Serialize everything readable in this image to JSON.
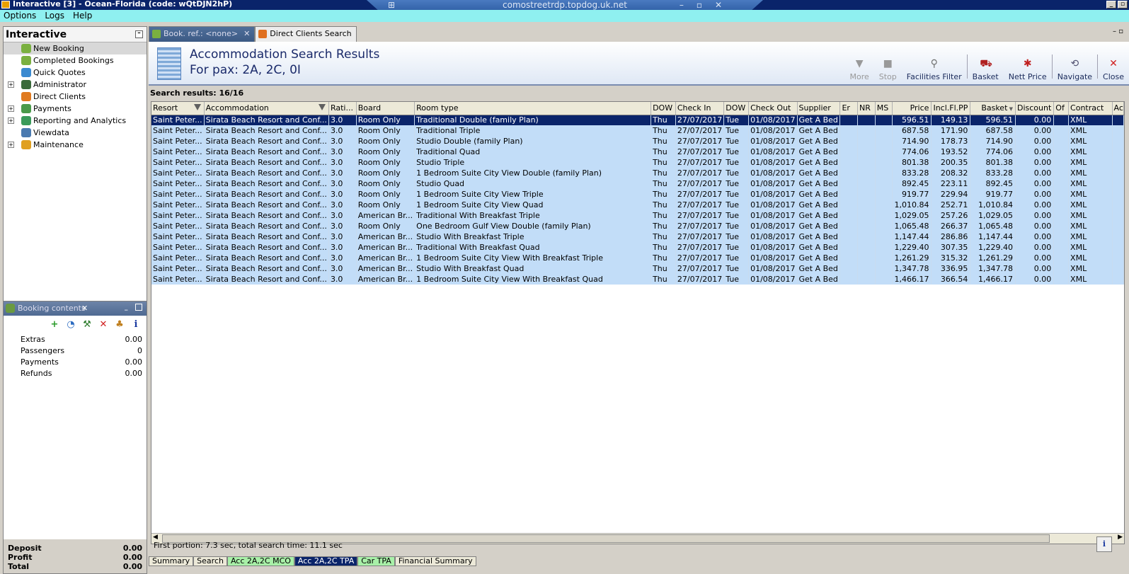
{
  "window": {
    "title": "Interactive [3] - Ocean-Florida (code: wQtDJN2hP)",
    "rdp_host": "comostreetrdp.topdog.uk.net"
  },
  "menu": [
    "Options",
    "Logs",
    "Help"
  ],
  "left_panel": {
    "title": "Interactive",
    "items": [
      {
        "label": "New Booking",
        "expandable": false,
        "selected": true,
        "icon": "palm-tree-icon"
      },
      {
        "label": "Completed Bookings",
        "expandable": false,
        "icon": "palm-tree-icon"
      },
      {
        "label": "Quick Quotes",
        "expandable": false,
        "icon": "clock-icon"
      },
      {
        "label": "Administrator",
        "expandable": true,
        "icon": "person-icon"
      },
      {
        "label": "Direct Clients",
        "expandable": false,
        "icon": "house-icon"
      },
      {
        "label": "Payments",
        "expandable": true,
        "icon": "money-icon"
      },
      {
        "label": "Reporting and Analytics",
        "expandable": true,
        "icon": "report-icon"
      },
      {
        "label": "Viewdata",
        "expandable": false,
        "icon": "screen-icon"
      },
      {
        "label": "Maintenance",
        "expandable": true,
        "icon": "toolbox-icon"
      }
    ]
  },
  "booking_panel": {
    "title": "Booking contents",
    "rows": [
      {
        "label": "Extras",
        "value": "0.00"
      },
      {
        "label": "Passengers",
        "value": "0"
      },
      {
        "label": "Payments",
        "value": "0.00"
      },
      {
        "label": "Refunds",
        "value": "0.00"
      }
    ],
    "totals": [
      {
        "label": "Deposit",
        "value": "0.00"
      },
      {
        "label": "Profit",
        "value": "0.00"
      },
      {
        "label": "Total",
        "value": "0.00"
      }
    ]
  },
  "tabs": [
    {
      "label": "Book. ref.: <none>",
      "active": true,
      "closable": true
    },
    {
      "label": "Direct Clients Search",
      "active": false,
      "closable": false
    }
  ],
  "header": {
    "title": "Accommodation Search Results",
    "subtitle": "For pax: 2A, 2C, 0I"
  },
  "toolbar": [
    {
      "label": "More",
      "disabled": true,
      "icon": "arrow-down-icon"
    },
    {
      "label": "Stop",
      "disabled": true,
      "icon": "stop-icon"
    },
    {
      "label": "Facilities Filter",
      "disabled": false,
      "icon": "filter-icon"
    },
    {
      "label": "Basket",
      "disabled": false,
      "icon": "basket-icon"
    },
    {
      "label": "Nett Price",
      "disabled": false,
      "icon": "nett-price-icon"
    },
    {
      "label": "Navigate",
      "disabled": false,
      "icon": "navigate-icon"
    },
    {
      "label": "Close",
      "disabled": false,
      "icon": "close-icon"
    }
  ],
  "search_results_label": "Search results: 16/16",
  "columns": [
    "Resort",
    "Accommodation",
    "Rati...",
    "Board",
    "Room type",
    "DOW",
    "Check In",
    "DOW",
    "Check Out",
    "Supplier",
    "Er",
    "NR",
    "MS",
    "Price",
    "Incl.Fl.PP",
    "Basket",
    "Discount",
    "Of",
    "Contract",
    "Ac"
  ],
  "rows": [
    [
      "Saint Peter...",
      "Sirata Beach Resort and Conf...",
      "3.0",
      "Room Only",
      "Traditional Double (family Plan)",
      "Thu",
      "27/07/2017",
      "Tue",
      "01/08/2017",
      "Get A Bed",
      "",
      "",
      "",
      "596.51",
      "149.13",
      "596.51",
      "0.00",
      "",
      "XML",
      ""
    ],
    [
      "Saint Peter...",
      "Sirata Beach Resort and Conf...",
      "3.0",
      "Room Only",
      "Traditional Triple",
      "Thu",
      "27/07/2017",
      "Tue",
      "01/08/2017",
      "Get A Bed",
      "",
      "",
      "",
      "687.58",
      "171.90",
      "687.58",
      "0.00",
      "",
      "XML",
      ""
    ],
    [
      "Saint Peter...",
      "Sirata Beach Resort and Conf...",
      "3.0",
      "Room Only",
      "Studio Double (family Plan)",
      "Thu",
      "27/07/2017",
      "Tue",
      "01/08/2017",
      "Get A Bed",
      "",
      "",
      "",
      "714.90",
      "178.73",
      "714.90",
      "0.00",
      "",
      "XML",
      ""
    ],
    [
      "Saint Peter...",
      "Sirata Beach Resort and Conf...",
      "3.0",
      "Room Only",
      "Traditional Quad",
      "Thu",
      "27/07/2017",
      "Tue",
      "01/08/2017",
      "Get A Bed",
      "",
      "",
      "",
      "774.06",
      "193.52",
      "774.06",
      "0.00",
      "",
      "XML",
      ""
    ],
    [
      "Saint Peter...",
      "Sirata Beach Resort and Conf...",
      "3.0",
      "Room Only",
      "Studio Triple",
      "Thu",
      "27/07/2017",
      "Tue",
      "01/08/2017",
      "Get A Bed",
      "",
      "",
      "",
      "801.38",
      "200.35",
      "801.38",
      "0.00",
      "",
      "XML",
      ""
    ],
    [
      "Saint Peter...",
      "Sirata Beach Resort and Conf...",
      "3.0",
      "Room Only",
      "1 Bedroom Suite City View Double (family Plan)",
      "Thu",
      "27/07/2017",
      "Tue",
      "01/08/2017",
      "Get A Bed",
      "",
      "",
      "",
      "833.28",
      "208.32",
      "833.28",
      "0.00",
      "",
      "XML",
      ""
    ],
    [
      "Saint Peter...",
      "Sirata Beach Resort and Conf...",
      "3.0",
      "Room Only",
      "Studio Quad",
      "Thu",
      "27/07/2017",
      "Tue",
      "01/08/2017",
      "Get A Bed",
      "",
      "",
      "",
      "892.45",
      "223.11",
      "892.45",
      "0.00",
      "",
      "XML",
      ""
    ],
    [
      "Saint Peter...",
      "Sirata Beach Resort and Conf...",
      "3.0",
      "Room Only",
      "1 Bedroom Suite City View Triple",
      "Thu",
      "27/07/2017",
      "Tue",
      "01/08/2017",
      "Get A Bed",
      "",
      "",
      "",
      "919.77",
      "229.94",
      "919.77",
      "0.00",
      "",
      "XML",
      ""
    ],
    [
      "Saint Peter...",
      "Sirata Beach Resort and Conf...",
      "3.0",
      "Room Only",
      "1 Bedroom Suite City View Quad",
      "Thu",
      "27/07/2017",
      "Tue",
      "01/08/2017",
      "Get A Bed",
      "",
      "",
      "",
      "1,010.84",
      "252.71",
      "1,010.84",
      "0.00",
      "",
      "XML",
      ""
    ],
    [
      "Saint Peter...",
      "Sirata Beach Resort and Conf...",
      "3.0",
      "American Br...",
      "Traditional With Breakfast Triple",
      "Thu",
      "27/07/2017",
      "Tue",
      "01/08/2017",
      "Get A Bed",
      "",
      "",
      "",
      "1,029.05",
      "257.26",
      "1,029.05",
      "0.00",
      "",
      "XML",
      ""
    ],
    [
      "Saint Peter...",
      "Sirata Beach Resort and Conf...",
      "3.0",
      "Room Only",
      "One Bedroom Gulf View Double (family Plan)",
      "Thu",
      "27/07/2017",
      "Tue",
      "01/08/2017",
      "Get A Bed",
      "",
      "",
      "",
      "1,065.48",
      "266.37",
      "1,065.48",
      "0.00",
      "",
      "XML",
      ""
    ],
    [
      "Saint Peter...",
      "Sirata Beach Resort and Conf...",
      "3.0",
      "American Br...",
      "Studio With Breakfast Triple",
      "Thu",
      "27/07/2017",
      "Tue",
      "01/08/2017",
      "Get A Bed",
      "",
      "",
      "",
      "1,147.44",
      "286.86",
      "1,147.44",
      "0.00",
      "",
      "XML",
      ""
    ],
    [
      "Saint Peter...",
      "Sirata Beach Resort and Conf...",
      "3.0",
      "American Br...",
      "Traditional With Breakfast Quad",
      "Thu",
      "27/07/2017",
      "Tue",
      "01/08/2017",
      "Get A Bed",
      "",
      "",
      "",
      "1,229.40",
      "307.35",
      "1,229.40",
      "0.00",
      "",
      "XML",
      ""
    ],
    [
      "Saint Peter...",
      "Sirata Beach Resort and Conf...",
      "3.0",
      "American Br...",
      "1 Bedroom Suite City View With Breakfast Triple",
      "Thu",
      "27/07/2017",
      "Tue",
      "01/08/2017",
      "Get A Bed",
      "",
      "",
      "",
      "1,261.29",
      "315.32",
      "1,261.29",
      "0.00",
      "",
      "XML",
      ""
    ],
    [
      "Saint Peter...",
      "Sirata Beach Resort and Conf...",
      "3.0",
      "American Br...",
      "Studio With Breakfast Quad",
      "Thu",
      "27/07/2017",
      "Tue",
      "01/08/2017",
      "Get A Bed",
      "",
      "",
      "",
      "1,347.78",
      "336.95",
      "1,347.78",
      "0.00",
      "",
      "XML",
      ""
    ],
    [
      "Saint Peter...",
      "Sirata Beach Resort and Conf...",
      "3.0",
      "American Br...",
      "1 Bedroom Suite City View With Breakfast Quad",
      "Thu",
      "27/07/2017",
      "Tue",
      "01/08/2017",
      "Get A Bed",
      "",
      "",
      "",
      "1,466.17",
      "366.54",
      "1,466.17",
      "0.00",
      "",
      "XML",
      ""
    ]
  ],
  "status_text": "First portion: 7.3 sec, total search time: 11.1 sec",
  "bottom_tabs": [
    {
      "label": "Summary",
      "style": "normal"
    },
    {
      "label": "Search",
      "style": "normal"
    },
    {
      "label": "Acc 2A,2C MCO",
      "style": "green"
    },
    {
      "label": "Acc 2A,2C TPA",
      "style": "blue"
    },
    {
      "label": "Car TPA",
      "style": "green"
    },
    {
      "label": "Financial Summary",
      "style": "normal"
    }
  ],
  "colors": {
    "selected_row": "#0a246a",
    "row_bg": "#c2ddf8",
    "menubar": "#8ff0f0",
    "header_title": "#1a2a6a"
  }
}
